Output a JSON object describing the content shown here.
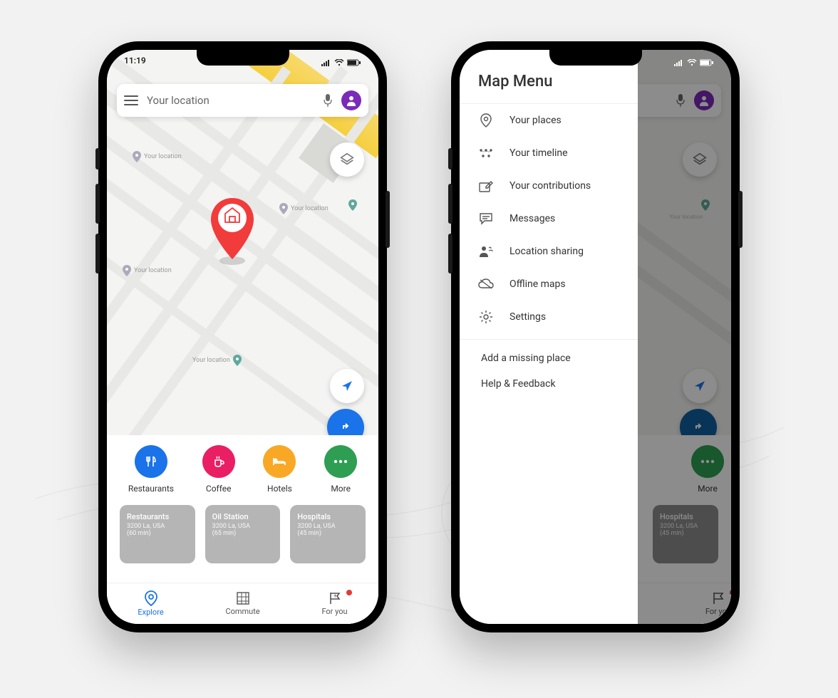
{
  "status": {
    "time": "11:19"
  },
  "search": {
    "placeholder": "Your location"
  },
  "pins": [
    {
      "label": "Your location"
    },
    {
      "label": "Your location"
    },
    {
      "label": "Your location"
    },
    {
      "label": "Your location"
    },
    {
      "label": "Your location"
    }
  ],
  "categories": [
    {
      "label": "Restaurants",
      "color": "c-blue"
    },
    {
      "label": "Coffee",
      "color": "c-pink"
    },
    {
      "label": "Hotels",
      "color": "c-orange"
    },
    {
      "label": "More",
      "color": "c-green"
    }
  ],
  "cards": [
    {
      "title": "Restaurants",
      "sub": "3200 La, USA",
      "time": "(60 min)"
    },
    {
      "title": "Oil Station",
      "sub": "3200 La, USA",
      "time": "(65 min)"
    },
    {
      "title": "Hospitals",
      "sub": "3200 La, USA",
      "time": "(45 min)"
    }
  ],
  "nav": [
    {
      "label": "Explore"
    },
    {
      "label": "Commute"
    },
    {
      "label": "For you"
    }
  ],
  "drawer": {
    "title": "Map Menu",
    "items": [
      {
        "label": "Your places"
      },
      {
        "label": "Your timeline"
      },
      {
        "label": "Your contributions"
      },
      {
        "label": "Messages"
      },
      {
        "label": "Location sharing"
      },
      {
        "label": "Offline maps"
      },
      {
        "label": "Settings"
      }
    ],
    "footer": [
      {
        "label": "Add a missing place"
      },
      {
        "label": "Help  &  Feedback"
      }
    ]
  }
}
